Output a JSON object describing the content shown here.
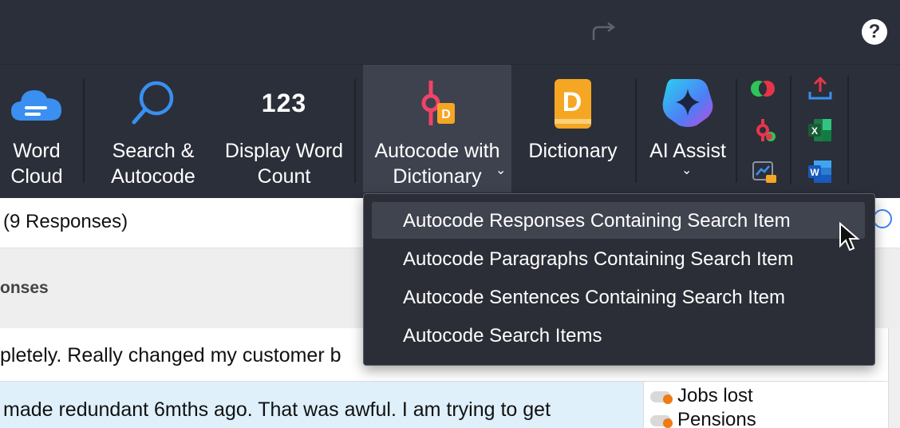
{
  "ribbon": {
    "word_cloud": "Word\nCloud",
    "search_autocode": "Search &\nAutocode",
    "display_word_count_icon": "123",
    "display_word_count": "Display Word\nCount",
    "autocode_dictionary": "Autocode with\nDictionary",
    "dictionary": "Dictionary",
    "ai_assist": "AI Assist",
    "chevron": "⌄"
  },
  "responses": {
    "title": "(9 Responses)",
    "column_header": "onses",
    "row1_text": "pletely. Really changed my customer b",
    "row2_line1": "made redundant 6mths ago. That was awful. I am trying to get",
    "row2_line2": ""
  },
  "codes": [
    "Jobs lost",
    "Pensions"
  ],
  "menu": {
    "items": [
      "Autocode Responses Containing Search Item",
      "Autocode Paragraphs Containing Search Item",
      "Autocode Sentences Containing Search Item",
      "Autocode Search Items"
    ],
    "hovered_index": 0
  },
  "colors": {
    "toolbar_bg": "#2b2f3a",
    "accent_blue": "#3b82f6",
    "dictionary_orange": "#f5a623",
    "autocode_pink": "#f0436a",
    "row_highlight": "#dff0fb"
  }
}
